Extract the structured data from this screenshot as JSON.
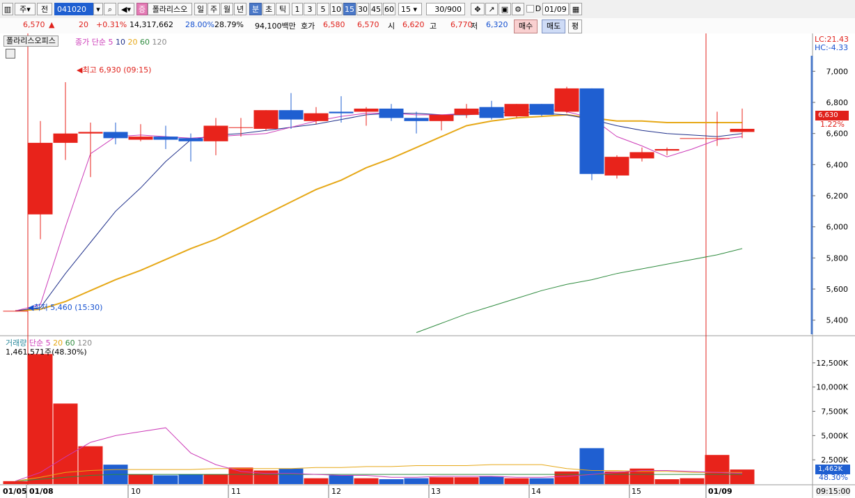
{
  "toolbar": {
    "period_label": "주",
    "prev_label": "전",
    "stock_code": "041020",
    "stock_name": "폴라리스오",
    "stock_tag": "증",
    "periods": [
      "일",
      "주",
      "월",
      "년",
      "분",
      "초",
      "틱"
    ],
    "active_period": "분",
    "intervals": [
      "1",
      "3",
      "5",
      "10",
      "15",
      "30",
      "45",
      "60"
    ],
    "active_interval": "15",
    "interval_select": "15",
    "count": "30/900",
    "checkbox_label": "D",
    "date": "01/09"
  },
  "quote": {
    "price": "6,570",
    "change_arrow": "▲",
    "change": "20",
    "change_pct": "+0.31%",
    "volume": "14,317,662",
    "ratio1": "28.00%",
    "ratio2": "28.79%",
    "amount": "94,100백만",
    "hoga_label": "호가",
    "hoga_ask": "6,580",
    "hoga_bid": "6,570",
    "open_label": "시",
    "open": "6,620",
    "high_label": "고",
    "high": "6,770",
    "low_label": "저",
    "low": "6,320",
    "buy_label": "매수",
    "sell_label": "매도",
    "eval_label": "평"
  },
  "price_panel": {
    "tab": "폴라리스오피스",
    "ma_label": "종가 단순",
    "ma_periods": [
      "5",
      "10",
      "20",
      "60",
      "120"
    ],
    "lc": "LC:21.43",
    "hc": "HC:-4.33",
    "current_price_label": "6,630",
    "current_pct_label": "1.22%",
    "high_annotation": "최고 6,930 (09:15)",
    "low_annotation": "최저 5,460 (15:30)"
  },
  "volume_panel": {
    "label": "거래량",
    "ma_label": "단순",
    "ma_periods": [
      "5",
      "20",
      "60",
      "120"
    ],
    "current_volume": "1,461,571주(48.30%)",
    "current_volume_label": "1,462K",
    "current_pct_label": "48.30%"
  },
  "time_axis": {
    "labels": [
      "01/05",
      "01/08",
      "10",
      "11",
      "12",
      "13",
      "14",
      "15",
      "01/09"
    ],
    "crosshair_time": "09:15:00"
  },
  "colors": {
    "up": "#e8231b",
    "down": "#1f5fd1",
    "ma5": "#cc3bb8",
    "ma10": "#1e2f8a",
    "ma20": "#e6a817",
    "ma60": "#2e8b3e",
    "ma120": "#888888",
    "crosshair": "#e0211b"
  },
  "chart_data": [
    {
      "type": "candlestick",
      "y_ticks": [
        5400,
        5600,
        5800,
        6000,
        6200,
        6400,
        6600,
        6800,
        7000
      ],
      "y_tick_labels": [
        "5,400",
        "5,600",
        "5,800",
        "6,000",
        "6,200",
        "6,400",
        "6,600",
        "6,800",
        "7,000"
      ],
      "ylim": [
        5300,
        7100
      ],
      "categories": [
        "01/05",
        "01/08",
        "",
        "",
        "",
        "",
        "10",
        "",
        "",
        "",
        "",
        "11",
        "",
        "",
        "",
        "12",
        "",
        "",
        "",
        "13",
        "",
        "",
        "",
        "14",
        "",
        "",
        "15",
        "",
        "",
        "01/09"
      ],
      "ohlc": [
        [
          5460,
          5460,
          5460,
          5460
        ],
        [
          6080,
          6680,
          5920,
          6540
        ],
        [
          6540,
          6930,
          6430,
          6600
        ],
        [
          6600,
          6670,
          6320,
          6610
        ],
        [
          6610,
          6670,
          6530,
          6570
        ],
        [
          6560,
          6660,
          6550,
          6580
        ],
        [
          6580,
          6650,
          6500,
          6560
        ],
        [
          6570,
          6600,
          6420,
          6550
        ],
        [
          6550,
          6700,
          6460,
          6650
        ],
        [
          6640,
          6700,
          6580,
          6640
        ],
        [
          6630,
          6750,
          6620,
          6750
        ],
        [
          6750,
          6860,
          6630,
          6690
        ],
        [
          6680,
          6770,
          6660,
          6730
        ],
        [
          6740,
          6840,
          6670,
          6730
        ],
        [
          6740,
          6770,
          6650,
          6760
        ],
        [
          6760,
          6790,
          6680,
          6700
        ],
        [
          6700,
          6740,
          6600,
          6680
        ],
        [
          6680,
          6720,
          6620,
          6720
        ],
        [
          6720,
          6790,
          6700,
          6760
        ],
        [
          6770,
          6810,
          6690,
          6700
        ],
        [
          6710,
          6790,
          6700,
          6790
        ],
        [
          6790,
          6790,
          6710,
          6720
        ],
        [
          6740,
          6900,
          6730,
          6890
        ],
        [
          6890,
          6890,
          6300,
          6340
        ],
        [
          6330,
          6460,
          6310,
          6450
        ],
        [
          6440,
          6510,
          6420,
          6480
        ],
        [
          6490,
          6510,
          6460,
          6500
        ],
        [
          6570,
          6570,
          6570,
          6570
        ],
        [
          6570,
          6740,
          6520,
          6570
        ],
        [
          6610,
          6760,
          6570,
          6630
        ]
      ],
      "ma5": [
        5460,
        5500,
        6000,
        6470,
        6580,
        6590,
        6580,
        6570,
        6580,
        6590,
        6600,
        6640,
        6680,
        6710,
        6730,
        6730,
        6720,
        6720,
        6730,
        6740,
        6750,
        6760,
        6740,
        6700,
        6580,
        6520,
        6450,
        6500,
        6560,
        6580
      ],
      "ma10": [
        5460,
        5480,
        5700,
        5900,
        6100,
        6250,
        6420,
        6560,
        6590,
        6600,
        6620,
        6640,
        6660,
        6690,
        6720,
        6730,
        6730,
        6720,
        6720,
        6730,
        6740,
        6730,
        6720,
        6690,
        6650,
        6620,
        6600,
        6590,
        6580,
        6600
      ],
      "ma20": [
        5460,
        5470,
        5520,
        5590,
        5660,
        5720,
        5790,
        5860,
        5920,
        6000,
        6080,
        6160,
        6240,
        6300,
        6380,
        6440,
        6510,
        6580,
        6650,
        6680,
        6700,
        6710,
        6720,
        6700,
        6680,
        6680,
        6670,
        6670,
        6670,
        6670
      ],
      "ma60": [
        null,
        null,
        null,
        null,
        null,
        null,
        null,
        null,
        null,
        null,
        null,
        null,
        null,
        null,
        null,
        null,
        5320,
        5380,
        5440,
        5490,
        5540,
        5590,
        5630,
        5660,
        5700,
        5730,
        5760,
        5790,
        5820,
        5860
      ]
    },
    {
      "type": "bar",
      "y_ticks": [
        2500,
        5000,
        7500,
        10000,
        12500
      ],
      "y_tick_labels": [
        "2,500K",
        "5,000K",
        "7,500K",
        "10,000K",
        "12,500K"
      ],
      "ylim": [
        0,
        14000
      ],
      "volumes": [
        300,
        13400,
        8300,
        3900,
        2000,
        1000,
        900,
        1000,
        1000,
        1700,
        1400,
        1600,
        600,
        900,
        600,
        500,
        600,
        700,
        700,
        800,
        600,
        600,
        1300,
        3700,
        1300,
        1600,
        500,
        600,
        3000,
        1500
      ],
      "vma5": [
        300,
        1200,
        2800,
        4300,
        5000,
        5400,
        5800,
        3200,
        2000,
        1300,
        1100,
        1100,
        1000,
        900,
        900,
        700,
        700,
        800,
        800,
        800,
        700,
        700,
        800,
        1000,
        1200,
        1400,
        1400,
        1300,
        1200,
        1100
      ],
      "vma20": [
        300,
        700,
        1200,
        1400,
        1500,
        1500,
        1500,
        1500,
        1600,
        1600,
        1600,
        1600,
        1700,
        1700,
        1800,
        1800,
        1900,
        1900,
        1900,
        2000,
        2000,
        2000,
        1600,
        1400,
        1400,
        1300,
        1300,
        1200,
        1200,
        1200
      ],
      "vma60": [
        300,
        500,
        700,
        900,
        1000,
        1000,
        1000,
        1000,
        1000,
        1000,
        1000,
        1000,
        1000,
        1000,
        1000,
        1000,
        1000,
        1000,
        1000,
        1000,
        1000,
        1000,
        1000,
        1000,
        1000,
        1000,
        1000,
        1000,
        1000,
        1000
      ]
    }
  ]
}
